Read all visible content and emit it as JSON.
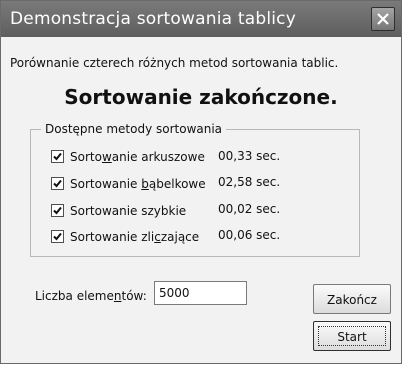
{
  "window": {
    "title": "Demonstracja sortowania tablicy"
  },
  "description": "Porównanie czterech różnych metod sortowania tablic.",
  "status": "Sortowanie zakończone.",
  "methods": {
    "legend": "Dostępne metody sortowania",
    "items": [
      {
        "pre": "Sorto",
        "acc": "w",
        "post": "anie arkuszowe",
        "checked": true,
        "time": "00,33 sec."
      },
      {
        "pre": "Sortowanie ",
        "acc": "b",
        "post": "ąbelkowe",
        "checked": true,
        "time": "02,58 sec."
      },
      {
        "pre": "Sortowanie szybkie",
        "acc": "",
        "post": "",
        "checked": true,
        "time": "00,02 sec."
      },
      {
        "pre": "Sortowanie zli",
        "acc": "c",
        "post": "zające",
        "checked": true,
        "time": "00,06 sec."
      }
    ]
  },
  "count": {
    "label_pre": "Liczba eleme",
    "label_acc": "n",
    "label_post": "tów:",
    "value": "5000"
  },
  "buttons": {
    "finish": "Zakończ",
    "start": "Start"
  }
}
